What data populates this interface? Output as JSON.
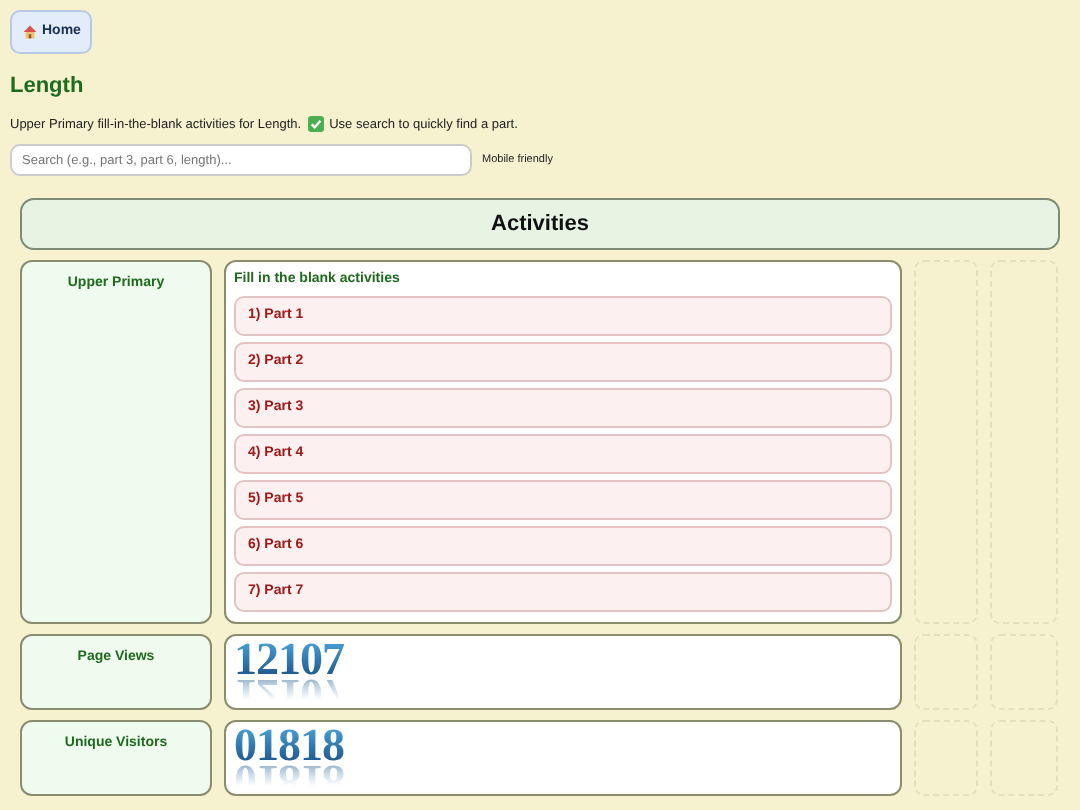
{
  "home_button": "Home",
  "title": "Length",
  "description": [
    "Upper Primary fill-in-the-blank activities for Length.",
    "Use search to quickly find a part."
  ],
  "search": {
    "placeholder": "Search (e.g., part 3, part 6, length)..."
  },
  "search_note": "Mobile friendly",
  "section_title": "Activities",
  "rows": [
    {
      "kind": "list",
      "label": "Upper Primary",
      "heading": "Fill in the blank activities",
      "items": [
        "1) Part 1",
        "2) Part 2",
        "3) Part 3",
        "4) Part 4",
        "5) Part 5",
        "6) Part 6",
        "7) Part 7"
      ]
    },
    {
      "kind": "counter",
      "label": "Page Views",
      "value": "12107"
    },
    {
      "kind": "counter",
      "label": "Unique Visitors",
      "value": "01818"
    }
  ]
}
